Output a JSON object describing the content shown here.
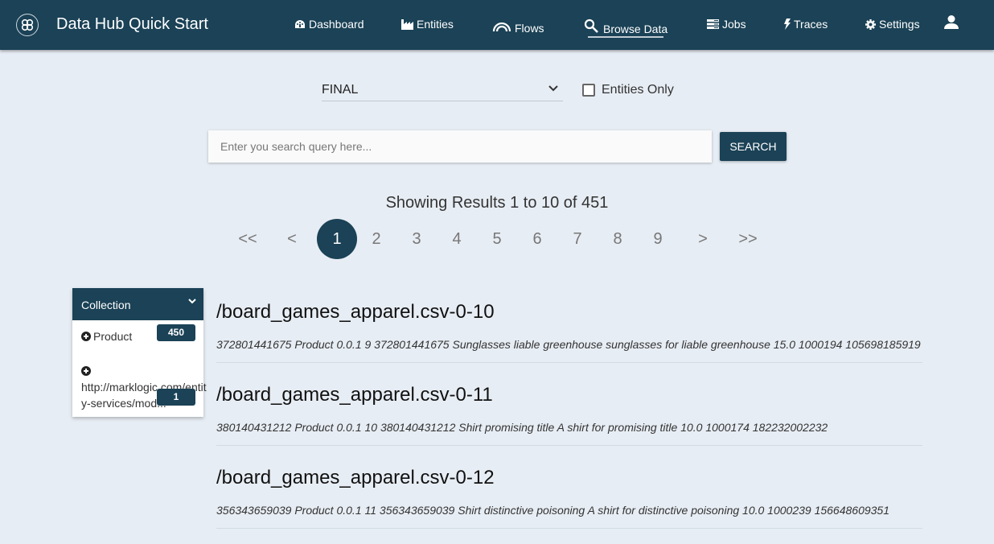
{
  "app": {
    "title": "Data Hub Quick Start",
    "logo_icon": "datahub-logo-icon"
  },
  "nav": {
    "items": [
      {
        "label": "Dashboard",
        "icon": "dashboard-gauge-icon"
      },
      {
        "label": "Entities",
        "icon": "factory-icon"
      },
      {
        "label": "Flows",
        "icon": "rainbow-arc-icon"
      },
      {
        "label": "Browse Data",
        "icon": "search-icon",
        "active": true
      },
      {
        "label": "Jobs",
        "icon": "server-stack-icon"
      },
      {
        "label": "Traces",
        "icon": "lightning-bolt-icon"
      },
      {
        "label": "Settings",
        "icon": "gear-icon"
      }
    ],
    "user_icon": "user-icon"
  },
  "filters": {
    "database": "FINAL",
    "entities_only_label": "Entities Only",
    "entities_only_checked": false
  },
  "search": {
    "placeholder": "Enter you search query here...",
    "value": "",
    "button_label": "SEARCH"
  },
  "results_summary": "Showing Results 1 to 10 of 451",
  "pagination": {
    "first": "<<",
    "prev": "<",
    "pages": [
      "1",
      "2",
      "3",
      "4",
      "5",
      "6",
      "7",
      "8",
      "9"
    ],
    "current": "1",
    "next": ">",
    "last": ">>"
  },
  "facets": {
    "title": "Collection",
    "items": [
      {
        "label": "Product",
        "count": "450"
      },
      {
        "label": "http://marklogic.com/entity-services/mod...",
        "count": "1"
      }
    ]
  },
  "results": [
    {
      "title": "/board_games_apparel.csv-0-10",
      "snippet": "372801441675 Product 0.0.1 9 372801441675 Sunglasses liable greenhouse sunglasses for liable greenhouse 15.0 1000194 105698185919"
    },
    {
      "title": "/board_games_apparel.csv-0-11",
      "snippet": "380140431212 Product 0.0.1 10 380140431212 Shirt promising title A shirt for promising title 10.0 1000174 182232002232"
    },
    {
      "title": "/board_games_apparel.csv-0-12",
      "snippet": "356343659039 Product 0.0.1 11 356343659039 Shirt distinctive poisoning A shirt for distinctive poisoning 10.0 1000239 156648609351"
    }
  ],
  "colors": {
    "primary": "#1b4256",
    "background": "#e7edf4"
  }
}
